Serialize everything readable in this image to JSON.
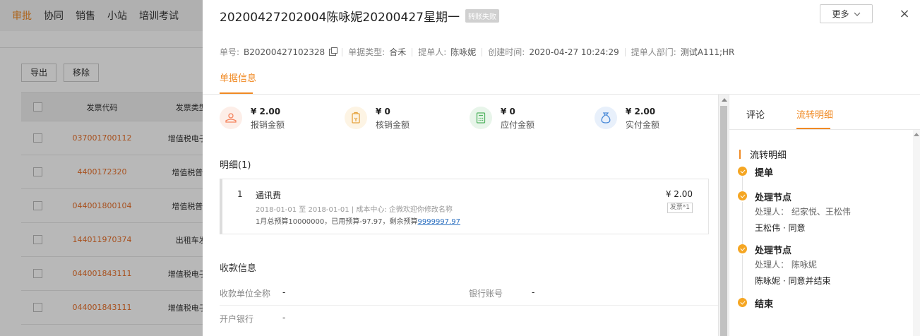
{
  "background": {
    "nav": [
      "审批",
      "协同",
      "销售",
      "小站",
      "培训考试"
    ],
    "buttons": [
      "导出",
      "移除"
    ],
    "table_headers": [
      "发票代码",
      "发票类型"
    ],
    "rows": [
      {
        "code": "037001700112",
        "type": "增值税电子普"
      },
      {
        "code": "4400172320",
        "type": "增值税普通"
      },
      {
        "code": "044001800104",
        "type": "增值税普通"
      },
      {
        "code": "144011970374",
        "type": "出租车发"
      },
      {
        "code": "044001843111",
        "type": "增值税电子普"
      },
      {
        "code": "044001843111",
        "type": "增值税电子普"
      }
    ]
  },
  "drawer": {
    "title": "20200427202004陈咏妮20200427星期一",
    "status_badge": "转账失败",
    "more_label": "更多",
    "close_label": "×",
    "meta": {
      "order_no_label": "单号:",
      "order_no": "B20200427102328",
      "type_label": "单据类型:",
      "type_value": "合禾",
      "submitter_label": "提单人:",
      "submitter": "陈咏妮",
      "created_label": "创建时间:",
      "created": "2020-04-27 10:24:29",
      "dept_label": "提单人部门:",
      "dept": "测试A111;HR"
    },
    "main_tab": "单据信息",
    "stats": [
      {
        "amount": "¥ 2.00",
        "label": "报销金额",
        "color": "#f5845e",
        "bg": "#fdeee8",
        "icon": "hand-coin-icon"
      },
      {
        "amount": "¥ 0",
        "label": "核销金额",
        "color": "#e6a23c",
        "bg": "#fdf4e4",
        "icon": "voucher-icon"
      },
      {
        "amount": "¥ 0",
        "label": "应付金额",
        "color": "#52b462",
        "bg": "#e8f5ea",
        "icon": "calculator-icon"
      },
      {
        "amount": "¥ 2.00",
        "label": "实付金额",
        "color": "#4a8ad8",
        "bg": "#e8f0fb",
        "icon": "money-bag-icon"
      }
    ],
    "detail_title": "明细(1)",
    "detail_item": {
      "index": "1",
      "name": "通讯费",
      "sub": "2018-01-01 至 2018-01-01 | 成本中心:  企微欢迎你修改名称",
      "budget_prefix": "1月总预算10000000，已用预算-97.97，剩余预算",
      "budget_remaining": "9999997.97",
      "amount": "¥ 2.00",
      "invoice_tag": "发票*1"
    },
    "payee_title": "收款信息",
    "payee": {
      "unit_label": "收款单位全称",
      "unit_value": "-",
      "account_label": "银行账号",
      "account_value": "-",
      "bank_label": "开户银行",
      "bank_value": "-"
    },
    "right_tabs": [
      "评论",
      "流转明细"
    ],
    "flow_title": "流转明细",
    "flow_nodes": [
      {
        "title": "提单",
        "handler": "",
        "result": ""
      },
      {
        "title": "处理节点",
        "handler": "处理人：  纪家悦、王松伟",
        "result": "王松伟 · 同意"
      },
      {
        "title": "处理节点",
        "handler": "处理人：  陈咏妮",
        "result": "陈咏妮 · 同意并结束"
      },
      {
        "title": "结束",
        "handler": "",
        "result": ""
      }
    ]
  }
}
